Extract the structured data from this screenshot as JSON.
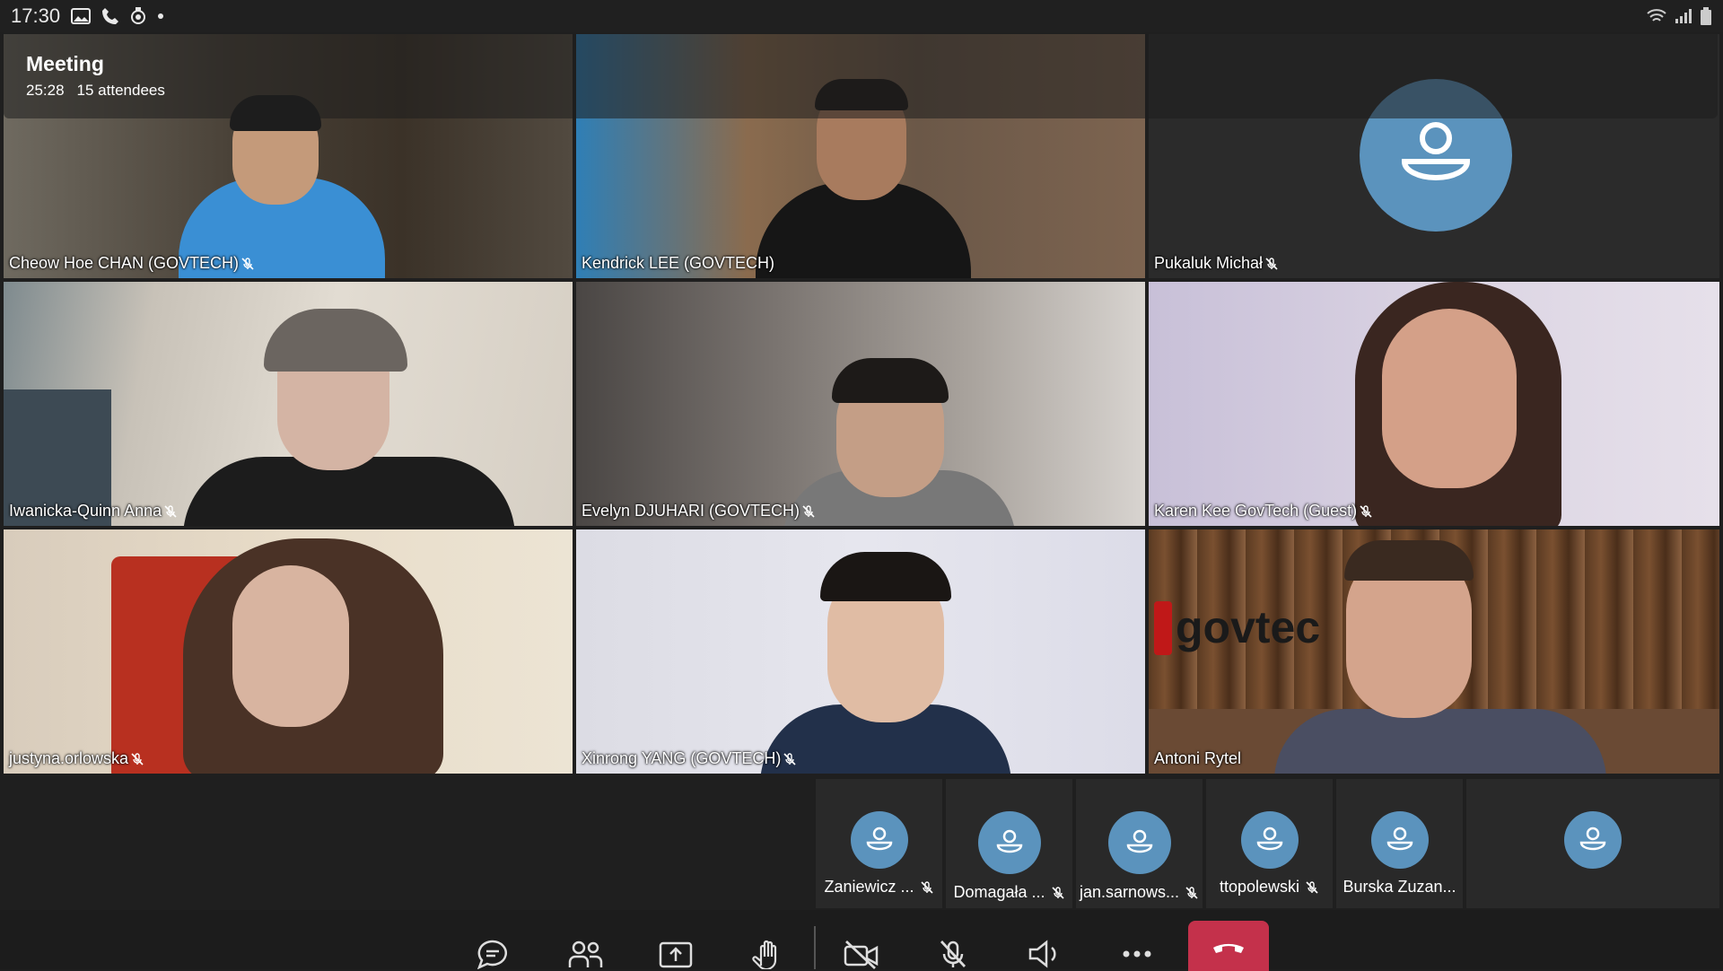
{
  "status_bar": {
    "time": "17:30",
    "left_icons": [
      "image-icon",
      "phone-icon",
      "location-icon",
      "dot-icon"
    ],
    "right_icons": [
      "wifi-icon",
      "signal-icon",
      "battery-icon"
    ]
  },
  "meeting": {
    "title": "Meeting",
    "duration": "25:28",
    "attendees": "15 attendees"
  },
  "participants": [
    {
      "name": "Cheow Hoe CHAN (GOVTECH)",
      "muted": true
    },
    {
      "name": "Kendrick LEE (GOVTECH)",
      "muted": false
    },
    {
      "name": "Pukaluk Michał",
      "muted": true
    },
    {
      "name": "Iwanicka-Quinn Anna",
      "muted": true
    },
    {
      "name": "Evelyn DJUHARI (GOVTECH)",
      "muted": true
    },
    {
      "name": "Karen Kee GovTech (Guest)",
      "muted": true
    },
    {
      "name": "justyna.orlowska",
      "muted": true
    },
    {
      "name": "Xinrong YANG (GOVTECH)",
      "muted": true
    },
    {
      "name": "Antoni Rytel",
      "muted": false
    }
  ],
  "video_overlay_text": "govtec",
  "mini_participants": [
    {
      "name": "Zaniewicz ...",
      "muted": true
    },
    {
      "name": "Domagała ...",
      "muted": true
    },
    {
      "name": "jan.sarnows...",
      "muted": true
    },
    {
      "name": "ttopolewski",
      "muted": true
    },
    {
      "name": "Burska Zuzan...",
      "muted": false
    },
    {
      "name": "",
      "muted": false
    }
  ],
  "controls": [
    "chat-icon",
    "people-icon",
    "share-screen-icon",
    "raise-hand-icon",
    "camera-off-icon",
    "mic-off-icon",
    "speaker-icon",
    "more-icon",
    "hang-up-icon"
  ],
  "colors": {
    "avatar": "#5b93bd",
    "hangup": "#c4314b",
    "background": "#1f1f1f"
  }
}
